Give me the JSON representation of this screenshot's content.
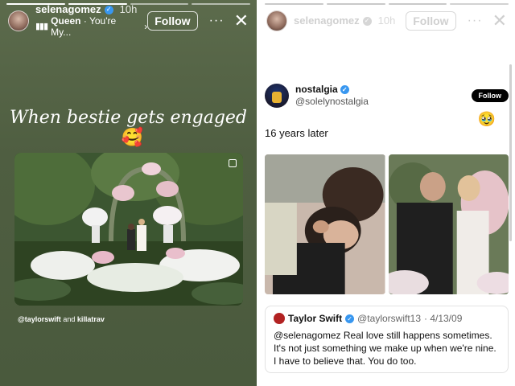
{
  "left_story": {
    "username": "selenagomez",
    "time": "10h",
    "music_song": "Queen",
    "music_artist": "You're My...",
    "follow_label": "Follow",
    "caption": "When bestie gets engaged",
    "caption_emoji": "🥰",
    "tag_1": "@taylorswift",
    "tag_and": "and",
    "tag_2": "killatrav"
  },
  "right_story": {
    "username": "selenagomez",
    "time": "10h",
    "follow_label": "Follow",
    "tweet": {
      "name": "nostalgia",
      "handle": "@solelynostalgia",
      "follow_label": "Follow",
      "text": "16 years later",
      "emoji": "🥹"
    },
    "quote": {
      "name": "Taylor Swift",
      "handle": "@taylorswift13",
      "date": "· 4/13/09",
      "body": "@selenagomez Real love still happens sometimes. It's not just something we make up when we're nine. I have to believe that. You do too."
    }
  },
  "colors": {
    "left_bg": "#4f5e41",
    "verified": "#3897f0",
    "tweet_follow_bg": "#000000"
  },
  "icons": [
    "verified-icon",
    "music-bars-icon",
    "chevron-right-icon",
    "more-icon",
    "close-icon",
    "square-icon"
  ]
}
